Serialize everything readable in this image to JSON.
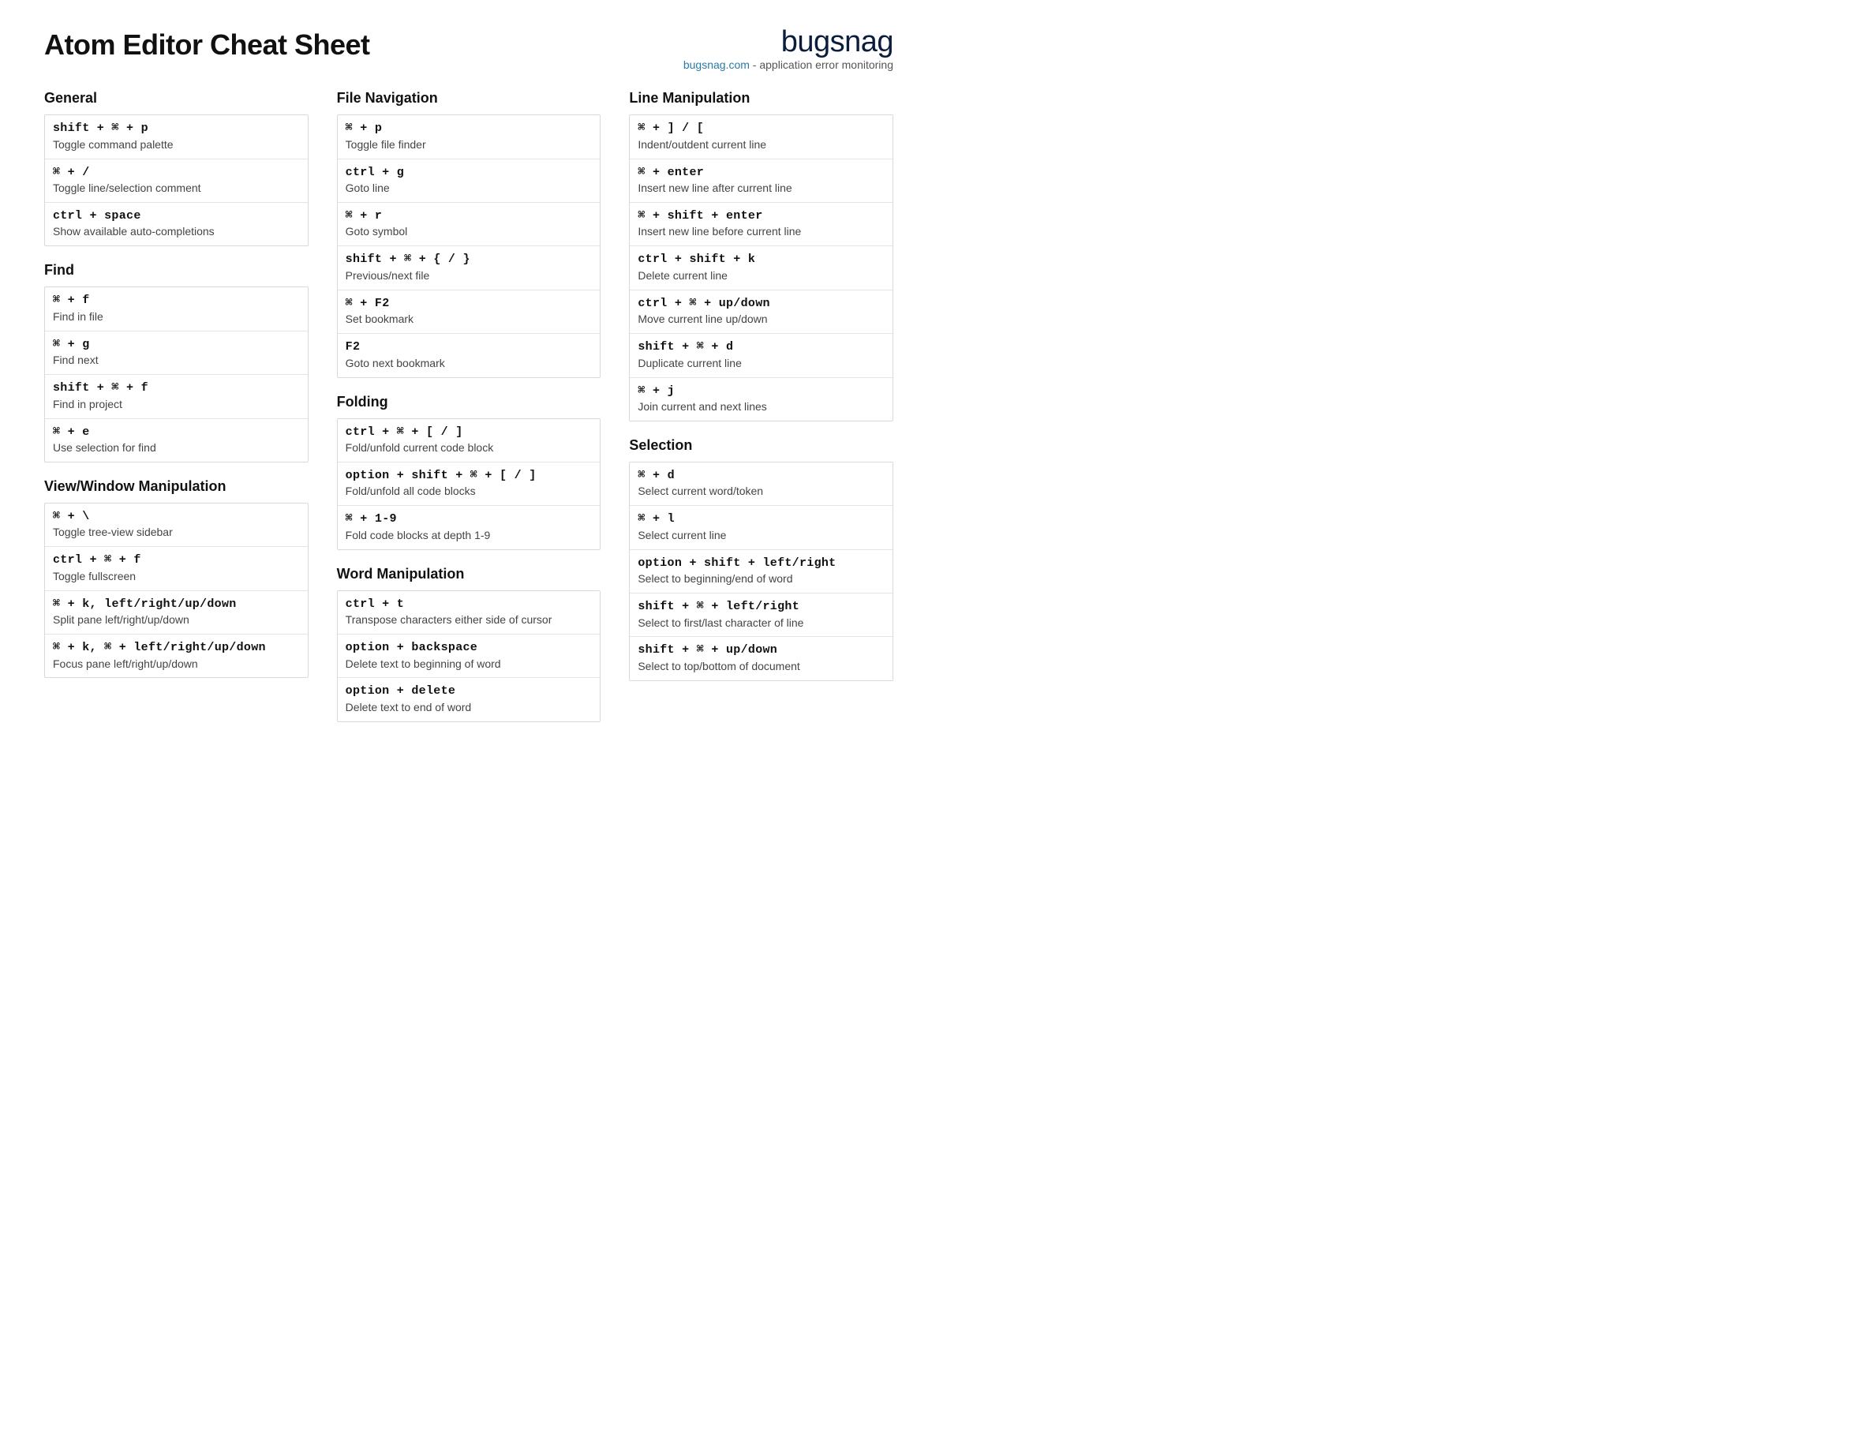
{
  "page": {
    "title": "Atom Editor Cheat Sheet",
    "brand": {
      "logo": "bugsnag",
      "link_text": "bugsnag.com",
      "tagline_rest": " - application error monitoring"
    }
  },
  "columns": [
    {
      "sections": [
        {
          "title": "General",
          "rows": [
            {
              "keys": "shift + ⌘ + p",
              "desc": "Toggle command palette"
            },
            {
              "keys": "⌘ + /",
              "desc": "Toggle line/selection comment"
            },
            {
              "keys": "ctrl + space",
              "desc": "Show available auto-completions"
            }
          ]
        },
        {
          "title": "Find",
          "rows": [
            {
              "keys": "⌘ + f",
              "desc": "Find in file"
            },
            {
              "keys": "⌘ + g",
              "desc": "Find next"
            },
            {
              "keys": "shift + ⌘ + f",
              "desc": "Find in project"
            },
            {
              "keys": "⌘ + e",
              "desc": "Use selection for find"
            }
          ]
        },
        {
          "title": "View/Window Manipulation",
          "rows": [
            {
              "keys": "⌘ + \\",
              "desc": "Toggle tree-view sidebar"
            },
            {
              "keys": "ctrl + ⌘ + f",
              "desc": "Toggle fullscreen"
            },
            {
              "keys": "⌘ + k, left/right/up/down",
              "desc": "Split pane left/right/up/down"
            },
            {
              "keys": "⌘ + k, ⌘ + left/right/up/down",
              "desc": "Focus pane left/right/up/down"
            }
          ]
        }
      ]
    },
    {
      "sections": [
        {
          "title": "File Navigation",
          "rows": [
            {
              "keys": "⌘ + p",
              "desc": "Toggle file finder"
            },
            {
              "keys": "ctrl + g",
              "desc": "Goto line"
            },
            {
              "keys": "⌘ + r",
              "desc": "Goto symbol"
            },
            {
              "keys": "shift + ⌘ + { / }",
              "desc": "Previous/next file"
            },
            {
              "keys": "⌘ + F2",
              "desc": "Set bookmark"
            },
            {
              "keys": "F2",
              "desc": "Goto next bookmark"
            }
          ]
        },
        {
          "title": "Folding",
          "rows": [
            {
              "keys": "ctrl + ⌘ + [ / ]",
              "desc": "Fold/unfold current code block"
            },
            {
              "keys": "option + shift + ⌘ + [ / ]",
              "desc": "Fold/unfold all code blocks"
            },
            {
              "keys": "⌘ + 1-9",
              "desc": "Fold code blocks at depth 1-9"
            }
          ]
        },
        {
          "title": "Word Manipulation",
          "rows": [
            {
              "keys": "ctrl + t",
              "desc": "Transpose characters either side of cursor"
            },
            {
              "keys": "option + backspace",
              "desc": "Delete text to beginning of word"
            },
            {
              "keys": "option + delete",
              "desc": "Delete text to end of word"
            }
          ]
        }
      ]
    },
    {
      "sections": [
        {
          "title": "Line Manipulation",
          "rows": [
            {
              "keys": "⌘ + ] / [",
              "desc": "Indent/outdent current line"
            },
            {
              "keys": "⌘ + enter",
              "desc": "Insert new line after current line"
            },
            {
              "keys": "⌘ + shift + enter",
              "desc": "Insert new line before current line"
            },
            {
              "keys": "ctrl + shift + k",
              "desc": "Delete current line"
            },
            {
              "keys": "ctrl + ⌘ + up/down",
              "desc": "Move current line up/down"
            },
            {
              "keys": "shift + ⌘ + d",
              "desc": "Duplicate current line"
            },
            {
              "keys": "⌘ + j",
              "desc": "Join current and next lines"
            }
          ]
        },
        {
          "title": "Selection",
          "rows": [
            {
              "keys": "⌘ + d",
              "desc": "Select current word/token"
            },
            {
              "keys": "⌘ + l",
              "desc": "Select current line"
            },
            {
              "keys": "option + shift + left/right",
              "desc": "Select to beginning/end of word"
            },
            {
              "keys": "shift + ⌘ + left/right",
              "desc": "Select to first/last character of line"
            },
            {
              "keys": "shift + ⌘ + up/down",
              "desc": "Select to top/bottom of document"
            }
          ]
        }
      ]
    }
  ]
}
